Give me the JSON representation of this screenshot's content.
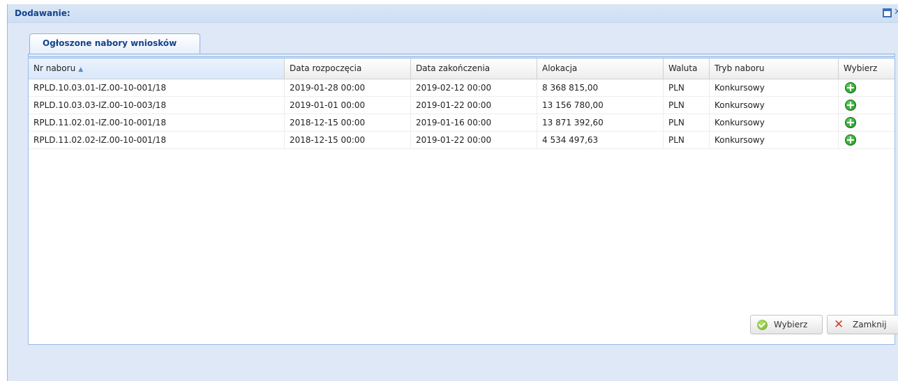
{
  "window": {
    "title": "Dodawanie:"
  },
  "tabs": [
    {
      "label": "Ogłoszone nabory wniosków"
    }
  ],
  "grid": {
    "columns": [
      {
        "label": "Nr naboru",
        "sorted": "asc"
      },
      {
        "label": "Data rozpoczęcia"
      },
      {
        "label": "Data zakończenia"
      },
      {
        "label": "Alokacja"
      },
      {
        "label": "Waluta"
      },
      {
        "label": "Tryb naboru"
      },
      {
        "label": "Wybierz"
      }
    ],
    "rows": [
      {
        "nr": "RPLD.10.03.01-IZ.00-10-001/18",
        "start": "2019-01-28 00:00",
        "end": "2019-02-12 00:00",
        "alokacja": "8 368 815,00",
        "waluta": "PLN",
        "tryb": "Konkursowy"
      },
      {
        "nr": "RPLD.10.03.03-IZ.00-10-003/18",
        "start": "2019-01-01 00:00",
        "end": "2019-01-22 00:00",
        "alokacja": "13 156 780,00",
        "waluta": "PLN",
        "tryb": "Konkursowy"
      },
      {
        "nr": "RPLD.11.02.01-IZ.00-10-001/18",
        "start": "2018-12-15 00:00",
        "end": "2019-01-16 00:00",
        "alokacja": "13 871 392,60",
        "waluta": "PLN",
        "tryb": "Konkursowy"
      },
      {
        "nr": "RPLD.11.02.02-IZ.00-10-001/18",
        "start": "2018-12-15 00:00",
        "end": "2019-01-22 00:00",
        "alokacja": "4 534 497,63",
        "waluta": "PLN",
        "tryb": "Konkursowy"
      }
    ]
  },
  "footer": {
    "select_label": "Wybierz",
    "close_label": "Zamknij"
  },
  "icons": {
    "select": "ok-icon",
    "close": "x-icon",
    "row_action": "plus-icon"
  }
}
